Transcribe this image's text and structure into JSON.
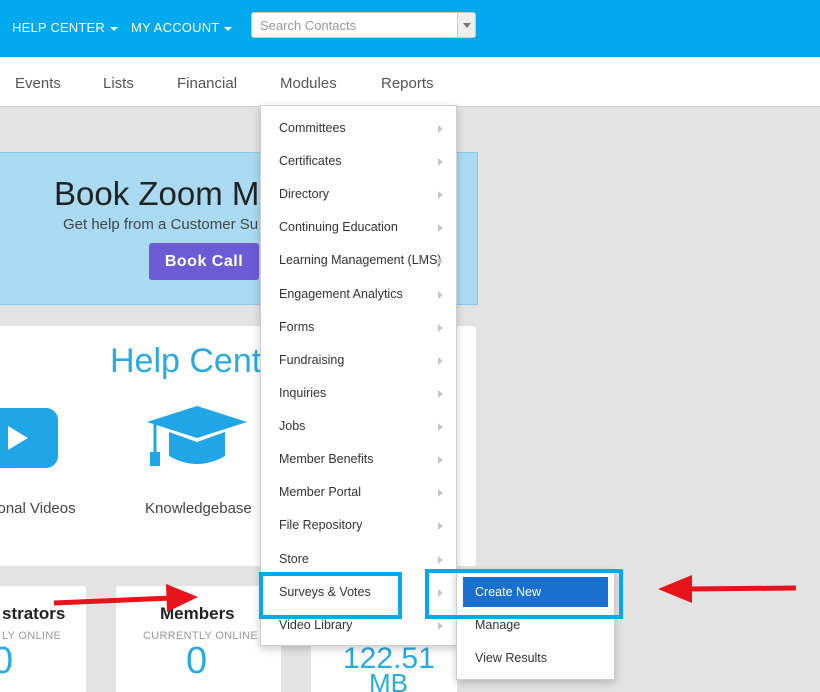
{
  "topbar": {
    "help_center": "HELP CENTER",
    "my_account": "MY ACCOUNT",
    "search_placeholder": "Search Contacts"
  },
  "subnav": {
    "items": [
      "Events",
      "Lists",
      "Financial",
      "Modules",
      "Reports"
    ]
  },
  "banner": {
    "title": "Book Zoom M",
    "subtitle": "Get help from a Customer Su",
    "button": "Book Call"
  },
  "help": {
    "title": "Help Cente",
    "videos_label": "tional Videos",
    "kb_label": "Knowledgebase"
  },
  "cards": [
    {
      "title": "strators",
      "sub": "LY ONLINE",
      "value": "0"
    },
    {
      "title": "Members",
      "sub": "CURRENTLY ONLINE",
      "value": "0"
    },
    {
      "value": "122.51",
      "unit": "MB"
    }
  ],
  "modules_menu": {
    "items": [
      "Committees",
      "Certificates",
      "Directory",
      "Continuing Education",
      "Learning Management (LMS)",
      "Engagement Analytics",
      "Forms",
      "Fundraising",
      "Inquiries",
      "Jobs",
      "Member Benefits",
      "Member Portal",
      "File Repository",
      "Store",
      "Surveys & Votes",
      "Video Library"
    ]
  },
  "surveys_submenu": {
    "items": [
      "Create New",
      "Manage",
      "View Results"
    ]
  },
  "colors": {
    "topbar": "#00a9ee",
    "accent": "#29abe2",
    "book_button": "#6d5bd6",
    "active_item": "#1b6fce",
    "annotation_highlight": "#00a9ee",
    "annotation_arrow": "#e8141b"
  }
}
